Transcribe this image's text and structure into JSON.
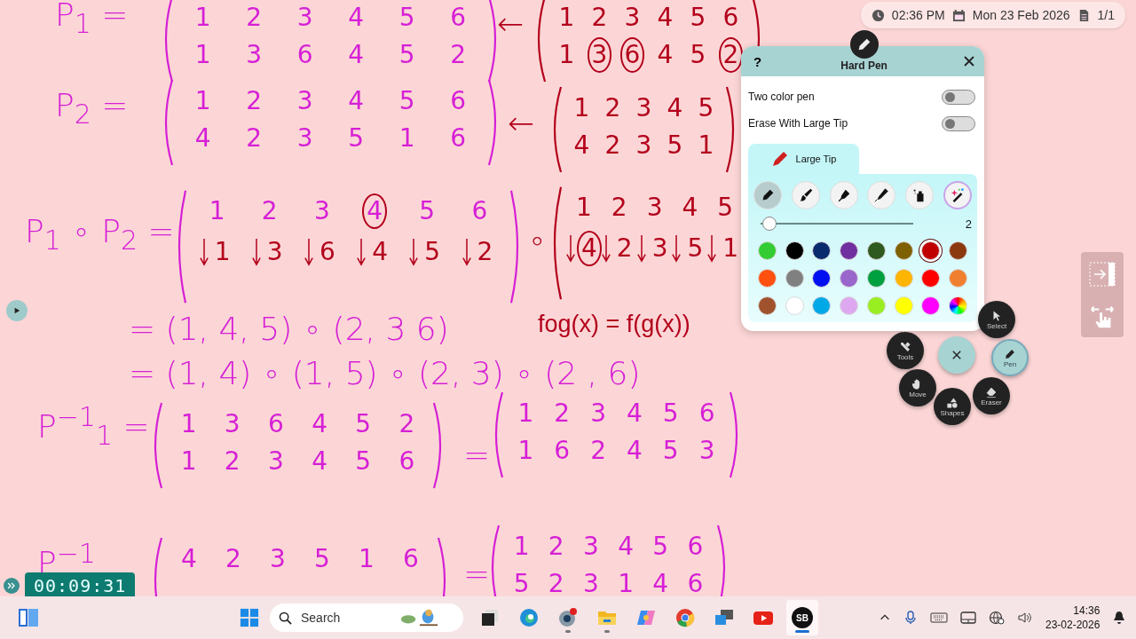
{
  "ink": [
    {
      "kind": "text",
      "color": "#d61fd6",
      "text": "P$_{1}$ ="
    },
    {
      "kind": "matrix",
      "color": "#d61fd6",
      "arrows": false,
      "rows": [
        {
          "color": "#d61fd6",
          "entries": [
            "1",
            "2",
            "3",
            "4",
            "5",
            "6"
          ]
        },
        {
          "color": "#d61fd6",
          "entries": [
            "1",
            "3",
            "6",
            "4",
            "5",
            "2"
          ]
        }
      ]
    },
    {
      "kind": "text",
      "color": "#b3001b",
      "text": "←"
    },
    {
      "kind": "matrix",
      "color": "#b3001b",
      "arrows": false,
      "rows": [
        {
          "color": "#b3001b",
          "entries": [
            "1",
            "2",
            "3",
            "4",
            "5",
            "6"
          ]
        },
        {
          "color": "#b3001b",
          "entries": [
            "1",
            "3",
            "6",
            "4",
            "5",
            "2"
          ],
          "circled": [
            false,
            true,
            true,
            false,
            false,
            true
          ]
        }
      ]
    },
    {
      "kind": "text",
      "color": "#d61fd6",
      "text": "P$_{2}$ ="
    },
    {
      "kind": "matrix",
      "color": "#d61fd6",
      "arrows": false,
      "rows": [
        {
          "color": "#d61fd6",
          "entries": [
            "1",
            "2",
            "3",
            "4",
            "5",
            "6"
          ]
        },
        {
          "color": "#d61fd6",
          "entries": [
            "4",
            "2",
            "3",
            "5",
            "1",
            "6"
          ]
        }
      ]
    },
    {
      "kind": "text",
      "color": "#b3001b",
      "text": "←"
    },
    {
      "kind": "matrix",
      "color": "#b3001b",
      "arrows": false,
      "rows": [
        {
          "color": "#b3001b",
          "entries": [
            "1",
            "2",
            "3",
            "4",
            "5"
          ]
        },
        {
          "color": "#b3001b",
          "entries": [
            "4",
            "2",
            "3",
            "5",
            "1"
          ]
        }
      ]
    },
    {
      "kind": "text",
      "color": "#d61fd6",
      "text": "P$_{1}$ ∘ P$_{2}$ ="
    },
    {
      "kind": "matrix",
      "color": "#d61fd6",
      "arrows": true,
      "rows": [
        {
          "color": "#d61fd6",
          "entries": [
            "1",
            "2",
            "3",
            "4",
            "5",
            "6"
          ],
          "circled": [
            false,
            false,
            false,
            true,
            false,
            false
          ]
        },
        {
          "color": "#b3001b",
          "entries": [
            "1",
            "3",
            "6",
            "4",
            "5",
            "2"
          ]
        }
      ]
    },
    {
      "kind": "text",
      "color": "#b3001b",
      "text": "∘"
    },
    {
      "kind": "matrix",
      "color": "#b3001b",
      "arrows": true,
      "rows": [
        {
          "color": "#b3001b",
          "entries": [
            "1",
            "2",
            "3",
            "4",
            "5"
          ]
        },
        {
          "color": "#b3001b",
          "entries": [
            "4",
            "2",
            "3",
            "5",
            "1"
          ],
          "circled": [
            true,
            false,
            false,
            false,
            false
          ]
        }
      ]
    },
    {
      "kind": "text",
      "color": "#d61fd6",
      "text": "= (1, 4, 5) ∘ (2, 3  6)"
    },
    {
      "kind": "text",
      "color": "#b3001b",
      "text": "fog(x) = f(g(x))"
    },
    {
      "kind": "text",
      "color": "#d61fd6",
      "text": "= (1, 4) ∘ (1, 5) ∘ (2, 3) ∘ (2 , 6)"
    },
    {
      "kind": "text",
      "color": "#d61fd6",
      "text": "P$^{−1}$$_{1}$ ="
    },
    {
      "kind": "matrix",
      "color": "#d61fd6",
      "arrows": false,
      "rows": [
        {
          "color": "#d61fd6",
          "entries": [
            "1",
            "3",
            "6",
            "4",
            "5",
            "2"
          ]
        },
        {
          "color": "#d61fd6",
          "entries": [
            "1",
            "2",
            "3",
            "4",
            "5",
            "6"
          ]
        }
      ]
    },
    {
      "kind": "text",
      "color": "#d61fd6",
      "text": "="
    },
    {
      "kind": "matrix",
      "color": "#d61fd6",
      "arrows": false,
      "rows": [
        {
          "color": "#d61fd6",
          "entries": [
            "1",
            "2",
            "3",
            "4",
            "5",
            "6"
          ]
        },
        {
          "color": "#d61fd6",
          "entries": [
            "1",
            "6",
            "2",
            "4",
            "5",
            "3"
          ]
        }
      ]
    },
    {
      "kind": "text",
      "color": "#d61fd6",
      "text": "P$^{−1}$"
    },
    {
      "kind": "matrix",
      "color": "#d61fd6",
      "rows": [
        {
          "color": "#d61fd6",
          "entries": [
            "4",
            "2",
            "3",
            "5",
            "1",
            "6"
          ]
        }
      ]
    },
    {
      "kind": "text",
      "color": "#d61fd6",
      "text": "="
    },
    {
      "kind": "matrix",
      "color": "#d61fd6",
      "arrows": false,
      "rows": [
        {
          "color": "#d61fd6",
          "entries": [
            "1",
            "2",
            "3",
            "4",
            "5",
            "6"
          ]
        },
        {
          "color": "#d61fd6",
          "entries": [
            "5",
            "2",
            "3",
            "1",
            "4",
            "6"
          ]
        }
      ]
    }
  ],
  "status_pill": {
    "time": "02:36 PM",
    "date": "Mon 23 Feb 2026",
    "page": "1/1"
  },
  "pen_panel": {
    "help": "?",
    "title": "Hard Pen",
    "toggles": [
      {
        "label": "Two color pen",
        "on": false
      },
      {
        "label": "Erase With Large Tip",
        "on": false
      }
    ],
    "tab": "Large Tip",
    "tips": [
      {
        "kind": "marker",
        "selected": true
      },
      {
        "kind": "brush",
        "selected": false
      },
      {
        "kind": "chisel",
        "selected": false
      },
      {
        "kind": "fineliner",
        "selected": false
      },
      {
        "kind": "spray",
        "selected": false
      },
      {
        "kind": "magic",
        "selected": false
      }
    ],
    "width": {
      "level": 0.05,
      "reading": "2"
    },
    "swatches": [
      {
        "kind": "swatch",
        "color": "#33cc33",
        "selected": false
      },
      {
        "kind": "swatch",
        "color": "#000000",
        "selected": false
      },
      {
        "kind": "swatch",
        "color": "#0a2a6e",
        "selected": false
      },
      {
        "kind": "swatch",
        "color": "#7030a0",
        "selected": false
      },
      {
        "kind": "swatch",
        "color": "#2f5a1f",
        "selected": false
      },
      {
        "kind": "swatch",
        "color": "#7f6000",
        "selected": false
      },
      {
        "kind": "swatch",
        "color": "#c00000",
        "selected": true
      },
      {
        "kind": "swatch",
        "color": "#8b3a0f",
        "selected": false
      },
      {
        "kind": "swatch",
        "color": "#ff5010",
        "selected": false
      },
      {
        "kind": "swatch",
        "color": "#808080",
        "selected": false
      },
      {
        "kind": "swatch",
        "color": "#0010f0",
        "selected": false
      },
      {
        "kind": "swatch",
        "color": "#9966cc",
        "selected": false
      },
      {
        "kind": "swatch",
        "color": "#00a040",
        "selected": false
      },
      {
        "kind": "swatch",
        "color": "#ffb400",
        "selected": false
      },
      {
        "kind": "swatch",
        "color": "#ff0000",
        "selected": false
      },
      {
        "kind": "swatch",
        "color": "#f08030",
        "selected": false
      },
      {
        "kind": "swatch",
        "color": "#a0522d",
        "selected": false
      },
      {
        "kind": "swatch",
        "color": "#ffffff",
        "selected": false
      },
      {
        "kind": "swatch",
        "color": "#00a8e8",
        "selected": false
      },
      {
        "kind": "swatch",
        "color": "#dda8f0",
        "selected": false
      },
      {
        "kind": "swatch",
        "color": "#99ee22",
        "selected": false
      },
      {
        "kind": "swatch",
        "color": "#ffff00",
        "selected": false
      },
      {
        "kind": "swatch",
        "color": "#ff00ff",
        "selected": false
      },
      {
        "kind": "picker",
        "selected": false
      }
    ]
  },
  "radial_menu": [
    {
      "kind": "select",
      "label": "Select",
      "selected": false
    },
    {
      "kind": "tools",
      "label": "Tools",
      "selected": false
    },
    {
      "kind": "close",
      "selected": false
    },
    {
      "kind": "pen",
      "label": "Pen",
      "selected": true
    },
    {
      "kind": "move",
      "label": "Move",
      "selected": false
    },
    {
      "kind": "shapes",
      "label": "Shapes",
      "selected": false
    },
    {
      "kind": "eraser",
      "label": "Eraser",
      "selected": false
    }
  ],
  "timer": "00:09:31",
  "taskbar": {
    "search_placeholder": "Search",
    "apps": [
      {
        "kind": "taskview",
        "running": false,
        "active": false
      },
      {
        "kind": "edge",
        "running": false,
        "active": false
      },
      {
        "kind": "camera",
        "running": true,
        "active": false
      },
      {
        "kind": "files",
        "running": true,
        "active": false
      },
      {
        "kind": "copilot",
        "running": false,
        "active": false
      },
      {
        "kind": "chrome",
        "running": false,
        "active": false
      },
      {
        "kind": "cast",
        "running": false,
        "active": false
      },
      {
        "kind": "youtube",
        "running": false,
        "active": false
      },
      {
        "kind": "sb",
        "label": "SB",
        "running": true,
        "active": true
      }
    ],
    "time": "14:36",
    "date": "23-02-2026"
  }
}
